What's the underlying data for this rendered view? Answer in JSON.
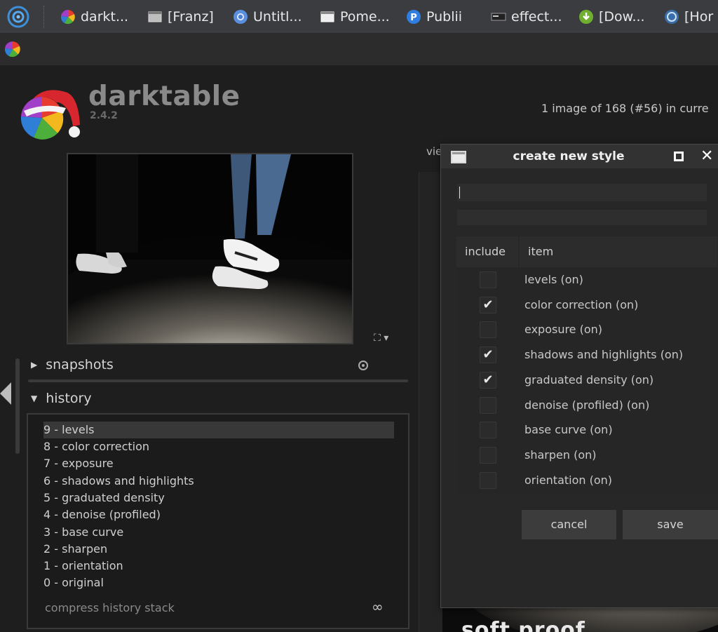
{
  "taskbar": {
    "tasks": [
      {
        "label": "darkt...",
        "icon": "darktable-icon"
      },
      {
        "label": "[Franz]",
        "icon": "window-icon"
      },
      {
        "label": "Untitl...",
        "icon": "chromium-icon"
      },
      {
        "label": "Pome...",
        "icon": "window-icon"
      },
      {
        "label": "Publii",
        "icon": "publii-icon"
      },
      {
        "label": "effect...",
        "icon": "terminal-icon"
      },
      {
        "label": "[Dow...",
        "icon": "download-icon"
      },
      {
        "label": "[Hor",
        "icon": "browser-icon"
      }
    ]
  },
  "app": {
    "name": "darktable",
    "version": "2.4.2",
    "image_count": "1 image of 168 (#56) in curre",
    "view_label": "vie"
  },
  "panels": {
    "snapshots": "snapshots",
    "history": "history",
    "history_items": [
      "9 - levels",
      "8 - color correction",
      "7 - exposure",
      "6 - shadows and highlights",
      "5 - graduated density",
      "4 - denoise (profiled)",
      "3 - base curve",
      "2 - sharpen",
      "1 - orientation",
      "0 - original"
    ],
    "compress": "compress history stack"
  },
  "dialog": {
    "title": "create new style",
    "name_value": "",
    "description_value": "",
    "columns": {
      "include": "include",
      "item": "item"
    },
    "items": [
      {
        "label": "levels  (on)",
        "checked": false
      },
      {
        "label": "color correction  (on)",
        "checked": true
      },
      {
        "label": "exposure  (on)",
        "checked": false
      },
      {
        "label": "shadows and highlights  (on)",
        "checked": true
      },
      {
        "label": "graduated density  (on)",
        "checked": true
      },
      {
        "label": "denoise (profiled)  (on)",
        "checked": false
      },
      {
        "label": "base curve  (on)",
        "checked": false
      },
      {
        "label": "sharpen  (on)",
        "checked": false
      },
      {
        "label": "orientation  (on)",
        "checked": false
      }
    ],
    "cancel": "cancel",
    "save": "save",
    "check_mark": "✔"
  },
  "overlay_text": "soft proof"
}
